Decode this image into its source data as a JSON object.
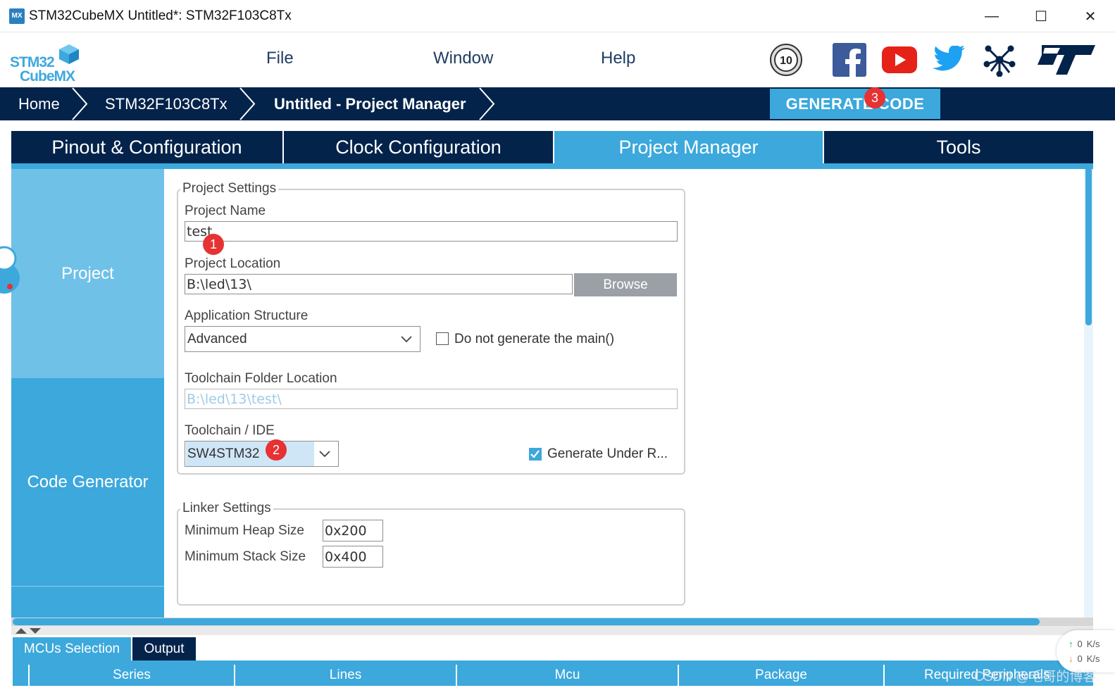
{
  "window": {
    "app_icon_text": "MX",
    "title": "STM32CubeMX Untitled*: STM32F103C8Tx",
    "minimize": "—",
    "maximize": "☐",
    "close": "✕"
  },
  "logo": {
    "line1": "STM32",
    "line2": "CubeMX"
  },
  "menu": {
    "file": "File",
    "window": "Window",
    "help": "Help"
  },
  "social_icons": [
    "anniversary-10-icon",
    "facebook-icon",
    "youtube-icon",
    "twitter-icon",
    "network-icon",
    "st-logo-icon"
  ],
  "anniversary_label": "10",
  "breadcrumb": {
    "home": "Home",
    "mcu": "STM32F103C8Tx",
    "current": "Untitled - Project Manager"
  },
  "generate_button": "GENERATE CODE",
  "tabs": {
    "pinout": "Pinout & Configuration",
    "clock": "Clock Configuration",
    "project_manager": "Project Manager",
    "tools": "Tools"
  },
  "sidebar": {
    "project": "Project",
    "code_generator": "Code Generator"
  },
  "project_settings": {
    "legend": "Project Settings",
    "name_label": "Project Name",
    "name_value": "test",
    "location_label": "Project Location",
    "location_value": "B:\\led\\13\\",
    "browse": "Browse",
    "app_structure_label": "Application Structure",
    "app_structure_value": "Advanced",
    "no_main_label": "Do not generate the main()",
    "toolchain_folder_label": "Toolchain Folder Location",
    "toolchain_folder_value": "B:\\led\\13\\test\\",
    "toolchain_label": "Toolchain / IDE",
    "toolchain_value": "SW4STM32",
    "generate_under_root_label": "Generate Under R..."
  },
  "linker_settings": {
    "legend": "Linker Settings",
    "heap_label": "Minimum Heap Size",
    "heap_value": "0x200",
    "stack_label": "Minimum Stack Size",
    "stack_value": "0x400"
  },
  "badges": {
    "b1": "1",
    "b2": "2",
    "b3": "3"
  },
  "bottom_tabs": {
    "mcus": "MCUs Selection",
    "output": "Output"
  },
  "table_columns": [
    "Series",
    "Lines",
    "Mcu",
    "Package",
    "Required Peripherals"
  ],
  "net_widget": {
    "up": "0",
    "down": "0",
    "unit": "K/s"
  },
  "watermark": "CSDN @毛哥的博客",
  "colors": {
    "navy": "#03234b",
    "accent": "#3ca8dc",
    "light_accent": "#6fc1e8",
    "badge": "#e63232"
  }
}
